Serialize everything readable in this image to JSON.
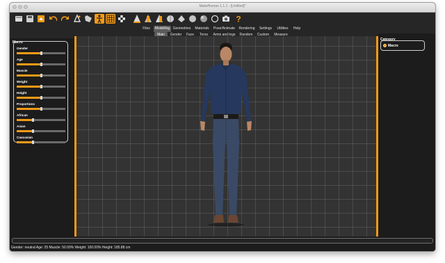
{
  "window": {
    "title": "MakeHuman 1.1.1 - [Untitled]*"
  },
  "toolbar": {
    "icons": [
      "undo-icon",
      "redo-icon",
      "reset-icon",
      "smooth-icon",
      "wireframe-icon",
      "background-icon",
      "pose-icon",
      "front-view-icon",
      "back-view-icon",
      "left-view-icon",
      "right-view-icon",
      "top-view-icon",
      "bottom-view-icon",
      "reset-camera-icon",
      "save-icon",
      "help-icon"
    ]
  },
  "main_tabs": [
    {
      "label": "Files"
    },
    {
      "label": "Modelling"
    },
    {
      "label": "Geometries"
    },
    {
      "label": "Materials"
    },
    {
      "label": "Pose/Animate"
    },
    {
      "label": "Rendering"
    },
    {
      "label": "Settings"
    },
    {
      "label": "Utilities"
    },
    {
      "label": "Help"
    }
  ],
  "sub_tabs": [
    {
      "label": "Main"
    },
    {
      "label": "Gender"
    },
    {
      "label": "Face"
    },
    {
      "label": "Torso"
    },
    {
      "label": "Arms and legs"
    },
    {
      "label": "Random"
    },
    {
      "label": "Custom"
    },
    {
      "label": "Measure"
    }
  ],
  "left_panel": {
    "title": "Macro",
    "sliders": [
      {
        "label": "Gender",
        "value": 0.5
      },
      {
        "label": "Age",
        "value": 0.5
      },
      {
        "label": "Muscle",
        "value": 0.5
      },
      {
        "label": "Weight",
        "value": 0.5
      },
      {
        "label": "Height",
        "value": 0.5
      },
      {
        "label": "Proportions",
        "value": 0.5
      },
      {
        "label": "African",
        "value": 0.333
      },
      {
        "label": "Asian",
        "value": 0.333
      },
      {
        "label": "Caucasian",
        "value": 0.333
      }
    ]
  },
  "right_panel": {
    "title": "Category",
    "option": "Macro"
  },
  "status": {
    "text": "Gender: neutral Age: 25 Muscle: 50.00% Weight: 100.00% Height: 185.88 cm"
  },
  "colors": {
    "accent": "#f39a17",
    "background": "#1c1c1c",
    "viewport": "#333333"
  }
}
